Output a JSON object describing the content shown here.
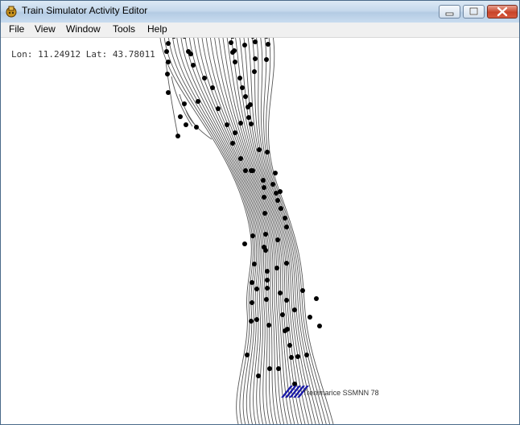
{
  "window": {
    "title": "Train Simulator Activity Editor",
    "icon": "tsae-app-icon",
    "controls": [
      "minimize-icon",
      "maximize-icon",
      "close-icon"
    ],
    "accent": "#c8442a"
  },
  "menu": {
    "items": [
      {
        "label": "File"
      },
      {
        "label": "View"
      },
      {
        "label": "Window"
      },
      {
        "label": "Tools"
      },
      {
        "label": "Help"
      }
    ]
  },
  "map": {
    "coords_text": "Lon: 11.24912 Lat: 43.78011",
    "watermark_text": "Trenimarice SSMNN 78",
    "track_color": "#555555",
    "node_color": "#000000",
    "logo_color": "#1a1aa8"
  }
}
